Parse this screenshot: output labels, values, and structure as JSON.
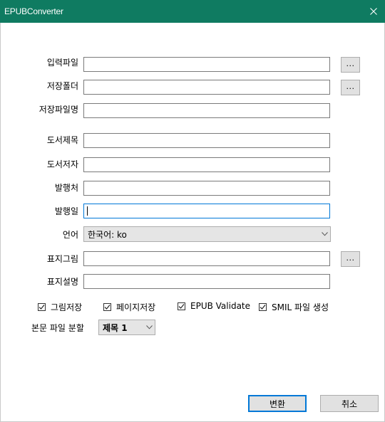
{
  "window": {
    "title": "EPUBConverter"
  },
  "form": {
    "input_file_label": "입력파일",
    "save_folder_label": "저장폴더",
    "save_filename_label": "저장파일명",
    "book_title_label": "도서제목",
    "book_author_label": "도서저자",
    "publisher_label": "발행처",
    "publish_date_label": "발행일",
    "language_label": "언어",
    "language_value": "한국어: ko",
    "cover_image_label": "표지그림",
    "cover_desc_label": "표지설명",
    "browse_label": "..."
  },
  "options": {
    "save_images": "그림저장",
    "save_pages": "페이지저장",
    "epub_validate": "EPUB Validate",
    "smil_generate": "SMIL 파일 생성"
  },
  "split": {
    "label": "본문 파일 분할",
    "value": "제목 1"
  },
  "buttons": {
    "convert": "변환",
    "cancel": "취소"
  }
}
